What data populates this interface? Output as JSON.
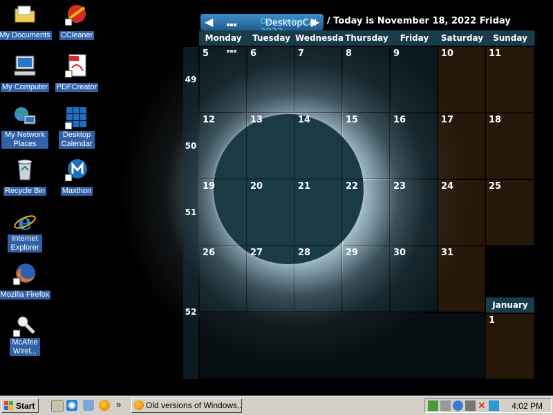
{
  "desktop_icons": [
    {
      "label": "My Documents",
      "icon": "folder-icon"
    },
    {
      "label": "CCleaner",
      "icon": "ccleaner-icon"
    },
    {
      "label": "My Computer",
      "icon": "computer-icon"
    },
    {
      "label": "PDFCreator",
      "icon": "pdf-icon"
    },
    {
      "label": "My Network Places",
      "icon": "network-icon"
    },
    {
      "label": "Desktop Calendar",
      "icon": "calendar-icon"
    },
    {
      "label": "Recycle Bin",
      "icon": "recycle-bin-icon"
    },
    {
      "label": "Maxthon",
      "icon": "maxthon-icon"
    },
    {
      "label": "Internet Explorer",
      "icon": "ie-icon"
    },
    {
      "label": "Mozilla Firefox",
      "icon": "firefox-icon"
    },
    {
      "label": "McAfee Wirel...",
      "icon": "mcafee-icon"
    }
  ],
  "calendar": {
    "month_label": "December 2022",
    "app_label": "DesktopCal",
    "today_text": "/ Today is November 18, 2022 Friday",
    "day_headers": [
      "Monday",
      "Tuesday",
      "Wednesday",
      "Thursday",
      "Friday",
      "Saturday",
      "Sunday"
    ],
    "week_numbers": [
      "49",
      "50",
      "51",
      "52"
    ],
    "rows": [
      [
        "5",
        "6",
        "7",
        "8",
        "9",
        "10",
        "11"
      ],
      [
        "12",
        "13",
        "14",
        "15",
        "16",
        "17",
        "18"
      ],
      [
        "19",
        "20",
        "21",
        "22",
        "23",
        "24",
        "25"
      ],
      [
        "26",
        "27",
        "28",
        "29",
        "30",
        "31",
        ""
      ]
    ],
    "next_month_label": "January",
    "next_month_first": "1"
  },
  "taskbar": {
    "start_label": "Start",
    "quick_launch_more": "»",
    "task_button_label": "Old versions of Windows,...",
    "clock": "4:02 PM"
  },
  "colors": {
    "taskbar": "#d4d0c8",
    "icon_label_bg": "#3162a8",
    "calendar_header": "#183c4a"
  }
}
